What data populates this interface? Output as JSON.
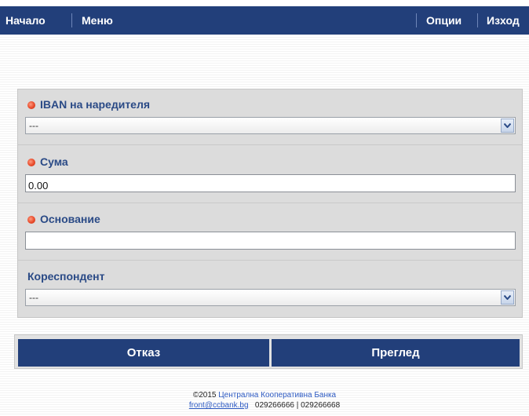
{
  "nav": {
    "home": "Начало",
    "menu": "Меню",
    "options": "Опции",
    "logout": "Изход"
  },
  "form": {
    "iban": {
      "label": "IBAN на наредителя",
      "value": "---",
      "required": true
    },
    "amount": {
      "label": "Сума",
      "value": "0.00",
      "required": true
    },
    "reason": {
      "label": "Основание",
      "value": "",
      "required": true
    },
    "correspondent": {
      "label": "Кореспондент",
      "value": "---",
      "required": false
    }
  },
  "buttons": {
    "cancel": "Отказ",
    "preview": "Преглед"
  },
  "footer": {
    "copyright": "©2015",
    "bank_name": "Централна Кооперативна Банка",
    "email": "front@ccbank.bg",
    "phones": "029266666 | 029266668"
  },
  "colors": {
    "primary": "#223f7a",
    "label": "#2a4a86",
    "required_dot": "#e84a2a",
    "panel": "#dcdcdc"
  }
}
